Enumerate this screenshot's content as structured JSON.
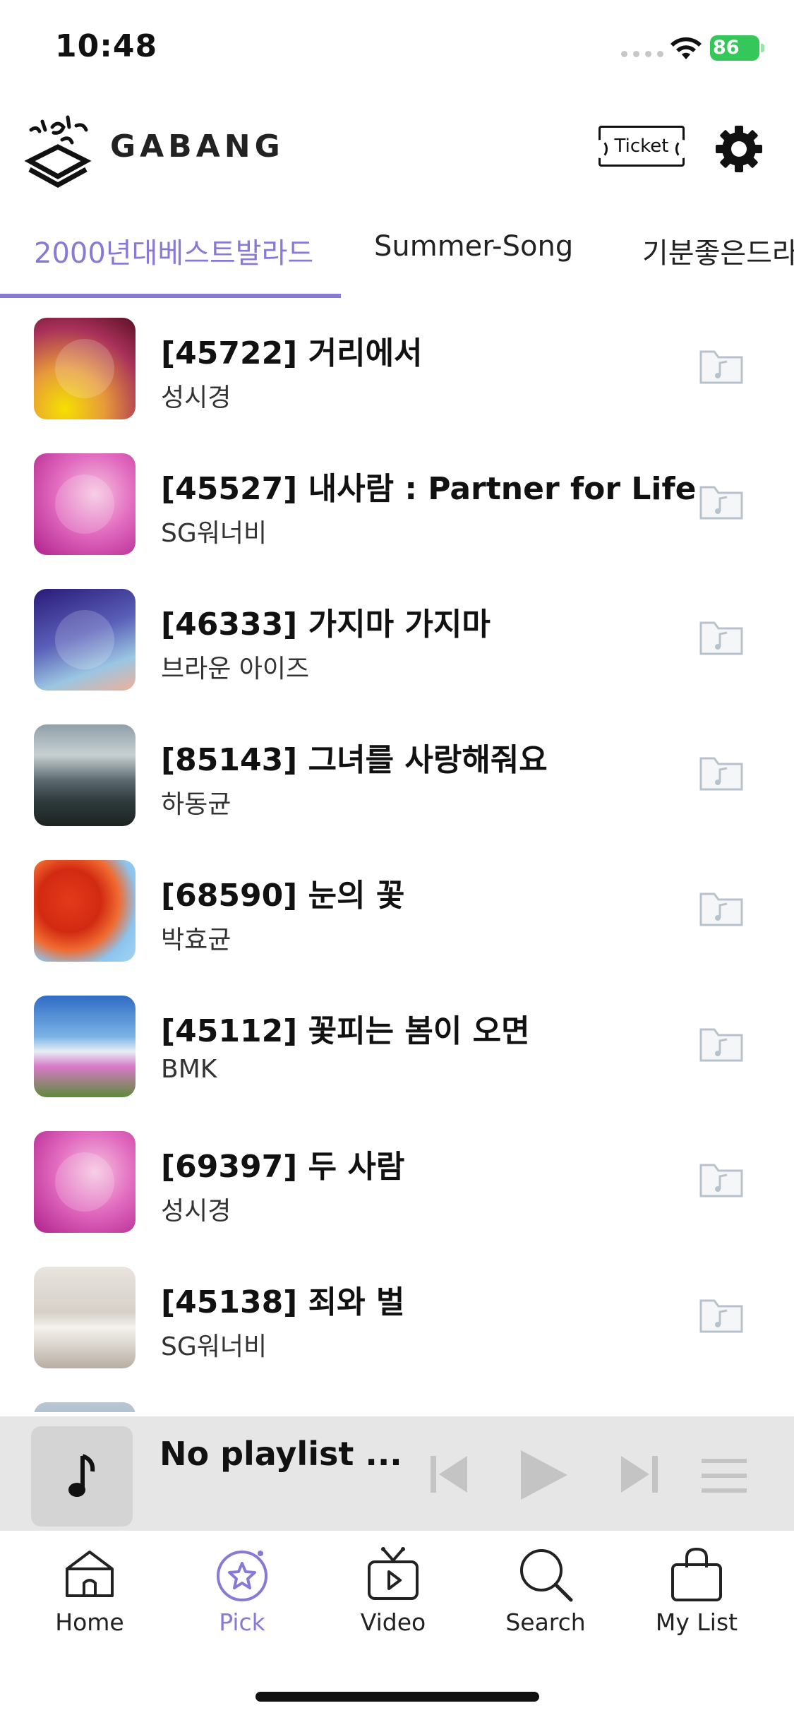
{
  "status_bar": {
    "time": "10:48",
    "battery": "86"
  },
  "header": {
    "brand": "GABANG",
    "ticket_label": "Ticket"
  },
  "tabs": [
    {
      "label": "2000년대베스트발라드",
      "active": true
    },
    {
      "label": "Summer-Song",
      "active": false
    },
    {
      "label": "기분좋은드라이브",
      "active": false
    }
  ],
  "songs": [
    {
      "title": "[45722] 거리에서",
      "artist": "성시경"
    },
    {
      "title": "[45527] 내사람 : Partner for Life",
      "artist": "SG워너비"
    },
    {
      "title": "[46333] 가지마 가지마",
      "artist": "브라운 아이즈"
    },
    {
      "title": "[85143] 그녀를 사랑해줘요",
      "artist": "하동균"
    },
    {
      "title": "[68590] 눈의 꽃",
      "artist": "박효균"
    },
    {
      "title": "[45112] 꽃피는 봄이 오면",
      "artist": "BMK"
    },
    {
      "title": "[69397] 두 사람",
      "artist": "성시경"
    },
    {
      "title": "[45138] 죄와 벌",
      "artist": "SG워너비"
    }
  ],
  "player": {
    "title": "No playlist ..."
  },
  "tab_bar": [
    {
      "label": "Home",
      "icon": "home-icon"
    },
    {
      "label": "Pick",
      "icon": "star-icon",
      "active": true
    },
    {
      "label": "Video",
      "icon": "tv-icon"
    },
    {
      "label": "Search",
      "icon": "search-icon"
    },
    {
      "label": "My List",
      "icon": "bag-icon"
    }
  ],
  "colors": {
    "accent": "#8a78d6",
    "battery": "#35c759",
    "player_bg": "#e6e6e6"
  }
}
